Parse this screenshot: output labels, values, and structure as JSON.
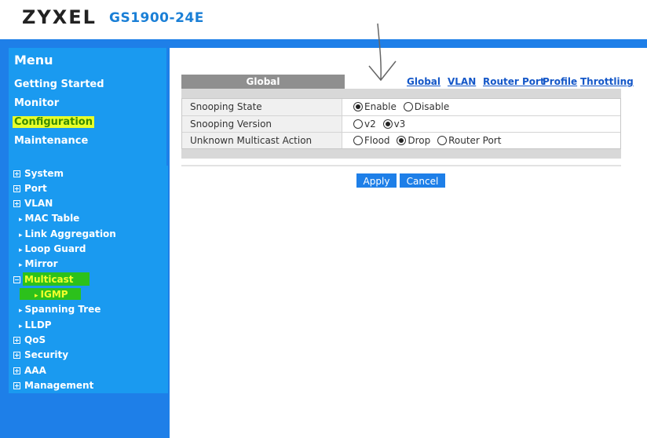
{
  "header": {
    "brand": "ZYXEL",
    "model": "GS1900-24E"
  },
  "menu": {
    "title": "Menu",
    "items": [
      "Getting Started",
      "Monitor",
      "Configuration",
      "Maintenance"
    ]
  },
  "tree": {
    "system": "System",
    "port": "Port",
    "vlan": "VLAN",
    "mac_table": "MAC Table",
    "link_aggregation": "Link Aggregation",
    "loop_guard": "Loop Guard",
    "mirror": "Mirror",
    "multicast": "Multicast",
    "igmp": "IGMP",
    "spanning_tree": "Spanning Tree",
    "lldp": "LLDP",
    "qos": "QoS",
    "security": "Security",
    "aaa": "AAA",
    "management": "Management"
  },
  "tabs": {
    "active": "Global",
    "links": [
      "Global",
      "VLAN",
      "Router Port",
      "Profile",
      "Throttling"
    ]
  },
  "settings": {
    "snooping_state": {
      "label": "Snooping State",
      "options": [
        "Enable",
        "Disable"
      ],
      "selected": "Enable"
    },
    "snooping_version": {
      "label": "Snooping Version",
      "options": [
        "v2",
        "v3"
      ],
      "selected": "v3"
    },
    "unknown_multicast": {
      "label": "Unknown Multicast Action",
      "options": [
        "Flood",
        "Drop",
        "Router Port"
      ],
      "selected": "Drop"
    }
  },
  "buttons": {
    "apply": "Apply",
    "cancel": "Cancel"
  },
  "colors": {
    "accent": "#1e7fe8",
    "highlight_yellow": "#e8ff28",
    "highlight_green": "#2cc11b"
  }
}
